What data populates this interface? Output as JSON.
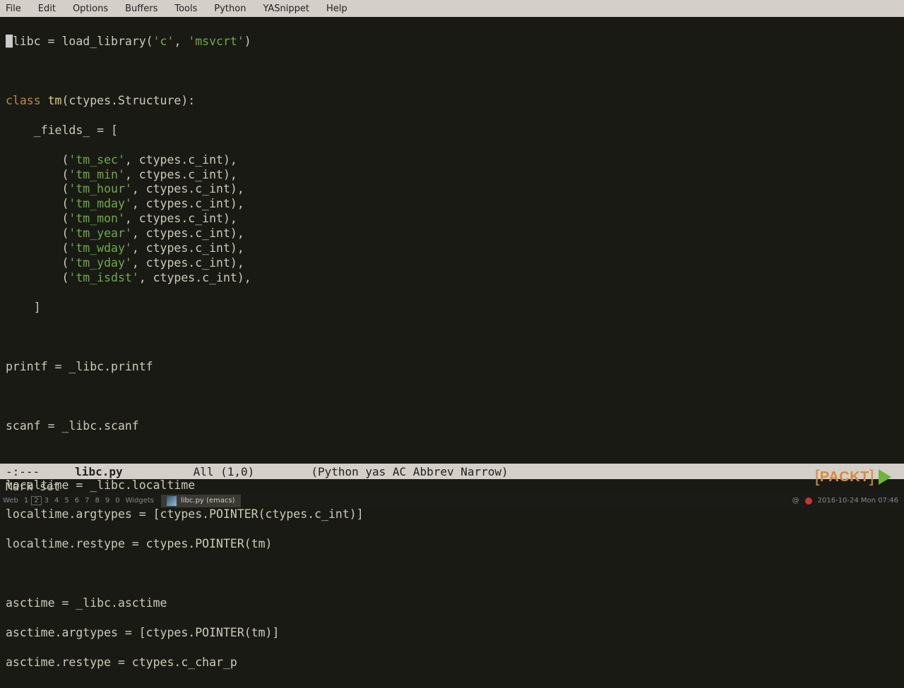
{
  "menubar": [
    "File",
    "Edit",
    "Options",
    "Buffers",
    "Tools",
    "Python",
    "YASnippet",
    "Help"
  ],
  "code": {
    "l1_pre": "_",
    "l1_rest": "libc = load_library(",
    "l1_s1": "'c'",
    "l1_mid": ", ",
    "l1_s2": "'msvcrt'",
    "l1_end": ")",
    "l3_kw": "class",
    "l3_sp": " ",
    "l3_cls": "tm",
    "l3_rest": "(ctypes.Structure):",
    "l4": "    _fields_ = [",
    "fields": [
      "'tm_sec'",
      "'tm_min'",
      "'tm_hour'",
      "'tm_mday'",
      "'tm_mon'",
      "'tm_year'",
      "'tm_wday'",
      "'tm_yday'",
      "'tm_isdst'"
    ],
    "field_pre": "        (",
    "field_post": ", ctypes.c_int),",
    "l_close": "    ]",
    "l_printf": "printf = _libc.printf",
    "l_scanf": "scanf = _libc.scanf",
    "l_lt1": "localtime = _libc.localtime",
    "l_lt2": "localtime.argtypes = [ctypes.POINTER(ctypes.c_int)]",
    "l_lt3": "localtime.restype = ctypes.POINTER(tm)",
    "l_at1": "asctime = _libc.asctime",
    "l_at2": "asctime.argtypes = [ctypes.POINTER(tm)]",
    "l_at3": "asctime.restype = ctypes.c_char_p"
  },
  "modeline": {
    "pre": "-:---",
    "file": "libc.py",
    "pos": "All (1,0)",
    "modes": "(Python yas AC Abbrev Narrow)"
  },
  "minibuf": "Mark set",
  "taskbar": {
    "web": "Web",
    "workspaces": [
      "1",
      "2",
      "3",
      "4",
      "5",
      "6",
      "7",
      "8",
      "9",
      "0"
    ],
    "widgets": "Widgets",
    "tab": "libc.py (emacs)",
    "at": "@",
    "time": "2016-10-24 Mon 07:46"
  },
  "logo": "PACKT"
}
